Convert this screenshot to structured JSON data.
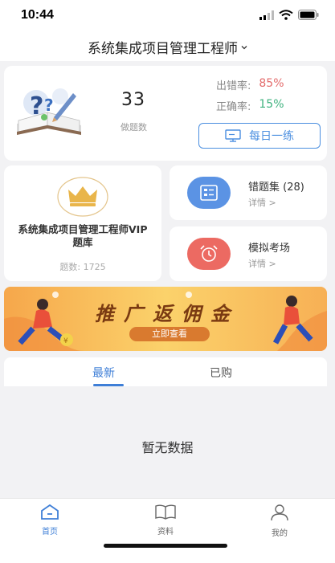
{
  "status_bar": {
    "time": "10:44"
  },
  "header": {
    "title": "系统集成项目管理工程师"
  },
  "stats": {
    "done_count": "33",
    "done_label": "做题数",
    "error_rate_label": "出错率:",
    "error_rate_value": "85%",
    "correct_rate_label": "正确率:",
    "correct_rate_value": "15%",
    "daily_button": "每日一练"
  },
  "vip": {
    "name": "系统集成项目管理工程师VIP题库",
    "count_label": "题数: 1725"
  },
  "entries": {
    "wrong": {
      "title": "错题集 (28)",
      "detail": "详情 >"
    },
    "mock": {
      "title": "模拟考场",
      "detail": "详情 >"
    }
  },
  "banner": {
    "title": "推广返佣金",
    "button": "立即查看"
  },
  "tabs": {
    "latest": "最新",
    "purchased": "已购"
  },
  "empty": {
    "text": "暂无数据"
  },
  "nav": {
    "home": "首页",
    "material": "资料",
    "mine": "我的"
  },
  "colors": {
    "accent": "#3f7fd7",
    "error": "#e36b6b",
    "correct": "#3fb27f"
  }
}
